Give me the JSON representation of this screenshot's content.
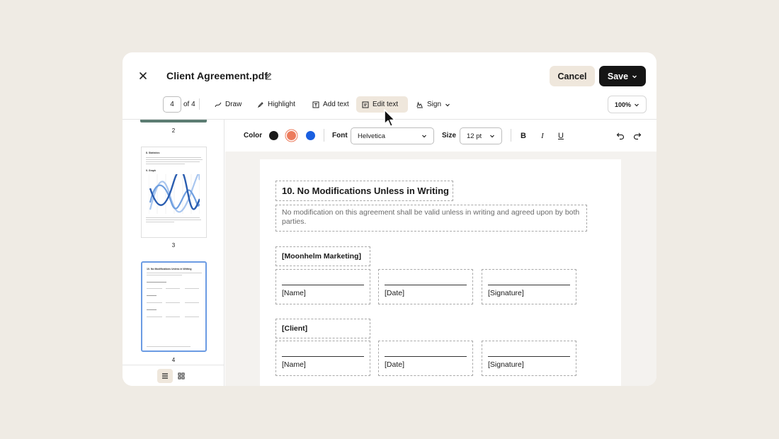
{
  "header": {
    "title": "Client Agreement.pdf",
    "cancel_label": "Cancel",
    "save_label": "Save"
  },
  "toolbar": {
    "page_current": "4",
    "page_of": "of 4",
    "tools": [
      {
        "label": "Draw",
        "icon": "draw-icon"
      },
      {
        "label": "Highlight",
        "icon": "highlighter-icon"
      },
      {
        "label": "Add text",
        "icon": "add-text-icon"
      },
      {
        "label": "Edit text",
        "icon": "edit-text-icon",
        "active": true
      },
      {
        "label": "Sign",
        "icon": "signature-icon"
      }
    ],
    "zoom": "100%"
  },
  "sidebar": {
    "pages": [
      {
        "number": "2"
      },
      {
        "number": "3",
        "heading_a": "8. Statistics",
        "heading_b": "9. Graph"
      },
      {
        "number": "4",
        "selected": true,
        "heading": "10. No Modifications Unless in Writing"
      }
    ]
  },
  "format_bar": {
    "color_label": "Color",
    "colors": [
      "#1a1a1a",
      "#ec7b5c",
      "#1a5fe0"
    ],
    "selected_color": "#ec7b5c",
    "font_label": "Font",
    "font_value": "Helvetica",
    "size_label": "Size",
    "size_value": "12 pt",
    "bold": "B",
    "italic": "I",
    "underline": "U"
  },
  "document": {
    "heading": "10. No Modifications Unless in Writing",
    "paragraph": "No modification on this agreement shall be valid unless in writing and agreed upon by both parties.",
    "parties": [
      {
        "name": "[Moonhelm Marketing]",
        "fields": [
          "[Name]",
          "[Date]",
          "[Signature]"
        ]
      },
      {
        "name": "[Client]",
        "fields": [
          "[Name]",
          "[Date]",
          "[Signature]"
        ]
      }
    ]
  },
  "colors": {
    "accent": "#efe7dc",
    "primary_button": "#151515",
    "selection": "#6b9be3",
    "chart_series": [
      "#2a5db0",
      "#6f9fe0",
      "#a9c6ef"
    ]
  }
}
